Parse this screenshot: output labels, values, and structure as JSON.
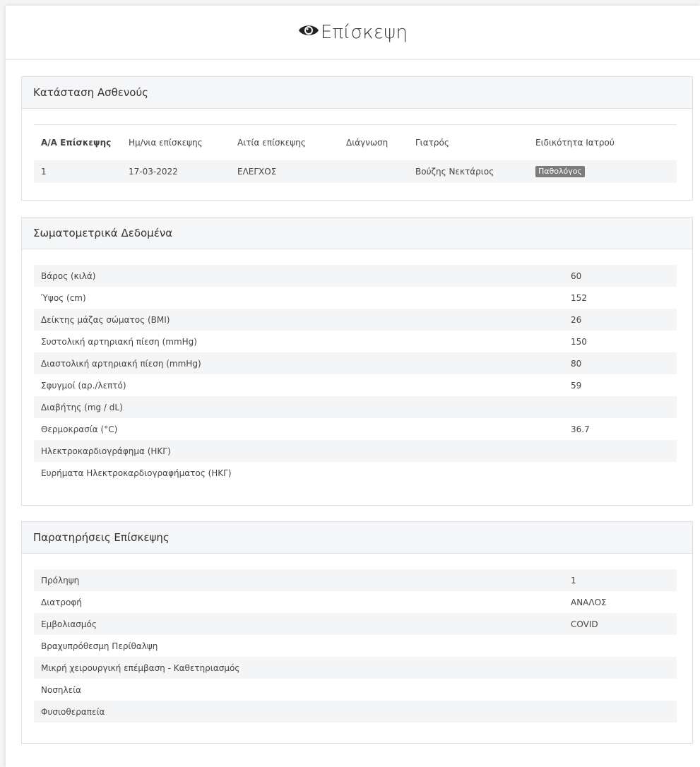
{
  "page": {
    "title": "Επίσκεψη",
    "title_icon": "eye-icon"
  },
  "patient_status": {
    "heading": "Κατάσταση Ασθενούς",
    "columns": [
      "Α/Α Επίσκεψης",
      "Ημ/νια επίσκεψης",
      "Αιτία επίσκεψης",
      "Διάγνωση",
      "Γιατρός",
      "Ειδικότητα Ιατρού"
    ],
    "rows": [
      {
        "visit_no": "1",
        "date": "17-03-2022",
        "reason": "ΕΛΕΓΧΟΣ",
        "diagnosis": "",
        "doctor": "Βούζης Νεκτάριος",
        "specialty": "Παθολόγος"
      }
    ]
  },
  "somatometric": {
    "heading": "Σωματομετρικά Δεδομένα",
    "rows": [
      {
        "label": "Βάρος (κιλά)",
        "value": "60"
      },
      {
        "label": "Ύψος (cm)",
        "value": "152"
      },
      {
        "label": "Δείκτης μάζας σώματος (BMI)",
        "value": "26"
      },
      {
        "label": "Συστολική αρτηριακή πίεση (mmHg)",
        "value": "150"
      },
      {
        "label": "Διαστολική αρτηριακή πίεση (mmHg)",
        "value": "80"
      },
      {
        "label": "Σφυγμοί (αρ./λεπτό)",
        "value": "59"
      },
      {
        "label": "Διαβήτης (mg / dL)",
        "value": ""
      },
      {
        "label": "Θερμοκρασία (°C)",
        "value": "36.7"
      },
      {
        "label": "Ηλεκτροκαρδιογράφημα (ΗΚΓ)",
        "value": ""
      },
      {
        "label": "Ευρήματα Ηλεκτροκαρδιογραφήματος (ΗΚΓ)",
        "value": ""
      }
    ]
  },
  "observations": {
    "heading": "Παρατηρήσεις Επίσκεψης",
    "rows": [
      {
        "label": "Πρόληψη",
        "value": "1"
      },
      {
        "label": "Διατροφή",
        "value": "ΑΝΑΛΟΣ"
      },
      {
        "label": "Εμβολιασμός",
        "value": "COVID"
      },
      {
        "label": "Βραχυπρόθεσμη Περίθαλψη",
        "value": ""
      },
      {
        "label": "Μικρή χειρουργική επέμβαση - Καθετηριασμός",
        "value": ""
      },
      {
        "label": "Νοσηλεία",
        "value": ""
      },
      {
        "label": "Φυσιοθεραπεία",
        "value": ""
      }
    ]
  },
  "colors": {
    "badge": "#7b7b7b",
    "panel_heading_bg": "#f5f6f8",
    "stripe": "#f4f5f7"
  }
}
